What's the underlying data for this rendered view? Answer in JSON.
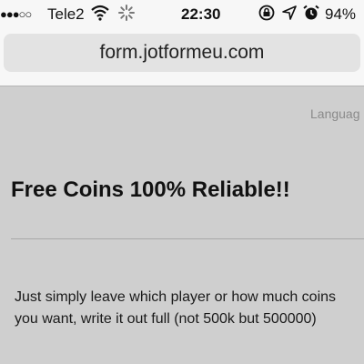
{
  "status_bar": {
    "signal_dots": "●●●○○",
    "carrier": "Tele2",
    "wifi_icon": "wifi-icon",
    "time": "22:30",
    "battery_percent": "94%"
  },
  "browser": {
    "url": "form.jotformeu.com"
  },
  "form": {
    "language_label": "Languag",
    "title": "Free Coins 100% Reliable!!",
    "description": "Just simply leave which player or how much coins you want, write it out full (not 500k but 500000)"
  }
}
